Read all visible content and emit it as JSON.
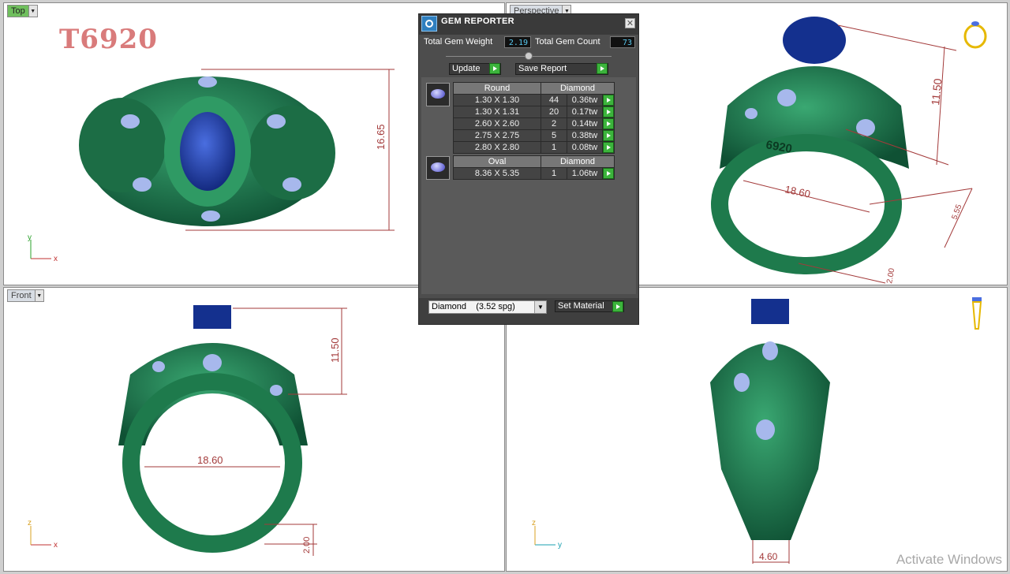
{
  "viewports": {
    "top": {
      "label": "Top",
      "axis_x": "x",
      "axis_y": "y",
      "part_code": "T6920",
      "dim_height": "16.65"
    },
    "perspective": {
      "label": "Perspective",
      "dims": [
        "11.50",
        "18.60",
        "5.55",
        "2.00"
      ],
      "engraving": "6920"
    },
    "front": {
      "label": "Front",
      "axis_x": "x",
      "axis_y": "z",
      "dims": [
        "11.50",
        "18.60",
        "2.00"
      ]
    },
    "right": {
      "axis_x": "y",
      "axis_y": "z",
      "dims": [
        "4.60"
      ]
    }
  },
  "gem_reporter": {
    "title": "GEM REPORTER",
    "total_weight_label": "Total Gem Weight",
    "total_weight": "2.19",
    "total_count_label": "Total Gem Count",
    "total_count": "73",
    "update_label": "Update",
    "save_label": "Save Report",
    "groups": [
      {
        "shape": "Round",
        "material": "Diamond",
        "rows": [
          {
            "size": "1.30 X 1.30",
            "count": "44",
            "weight": "0.36tw"
          },
          {
            "size": "1.30 X 1.31",
            "count": "20",
            "weight": "0.17tw"
          },
          {
            "size": "2.60 X 2.60",
            "count": "2",
            "weight": "0.14tw"
          },
          {
            "size": "2.75 X 2.75",
            "count": "5",
            "weight": "0.38tw"
          },
          {
            "size": "2.80 X 2.80",
            "count": "1",
            "weight": "0.08tw"
          }
        ]
      },
      {
        "shape": "Oval",
        "material": "Diamond",
        "rows": [
          {
            "size": "8.36 X 5.35",
            "count": "1",
            "weight": "1.06tw"
          }
        ]
      }
    ],
    "material_select": "Diamond    (3.52 spg)",
    "set_material_label": "Set Material"
  },
  "watermark": "Activate Windows",
  "colors": {
    "ring": "#1f7a4e",
    "stone": "#1f3fa8",
    "dim": "#a33a3a",
    "active_tab": "#6fbf5d"
  }
}
